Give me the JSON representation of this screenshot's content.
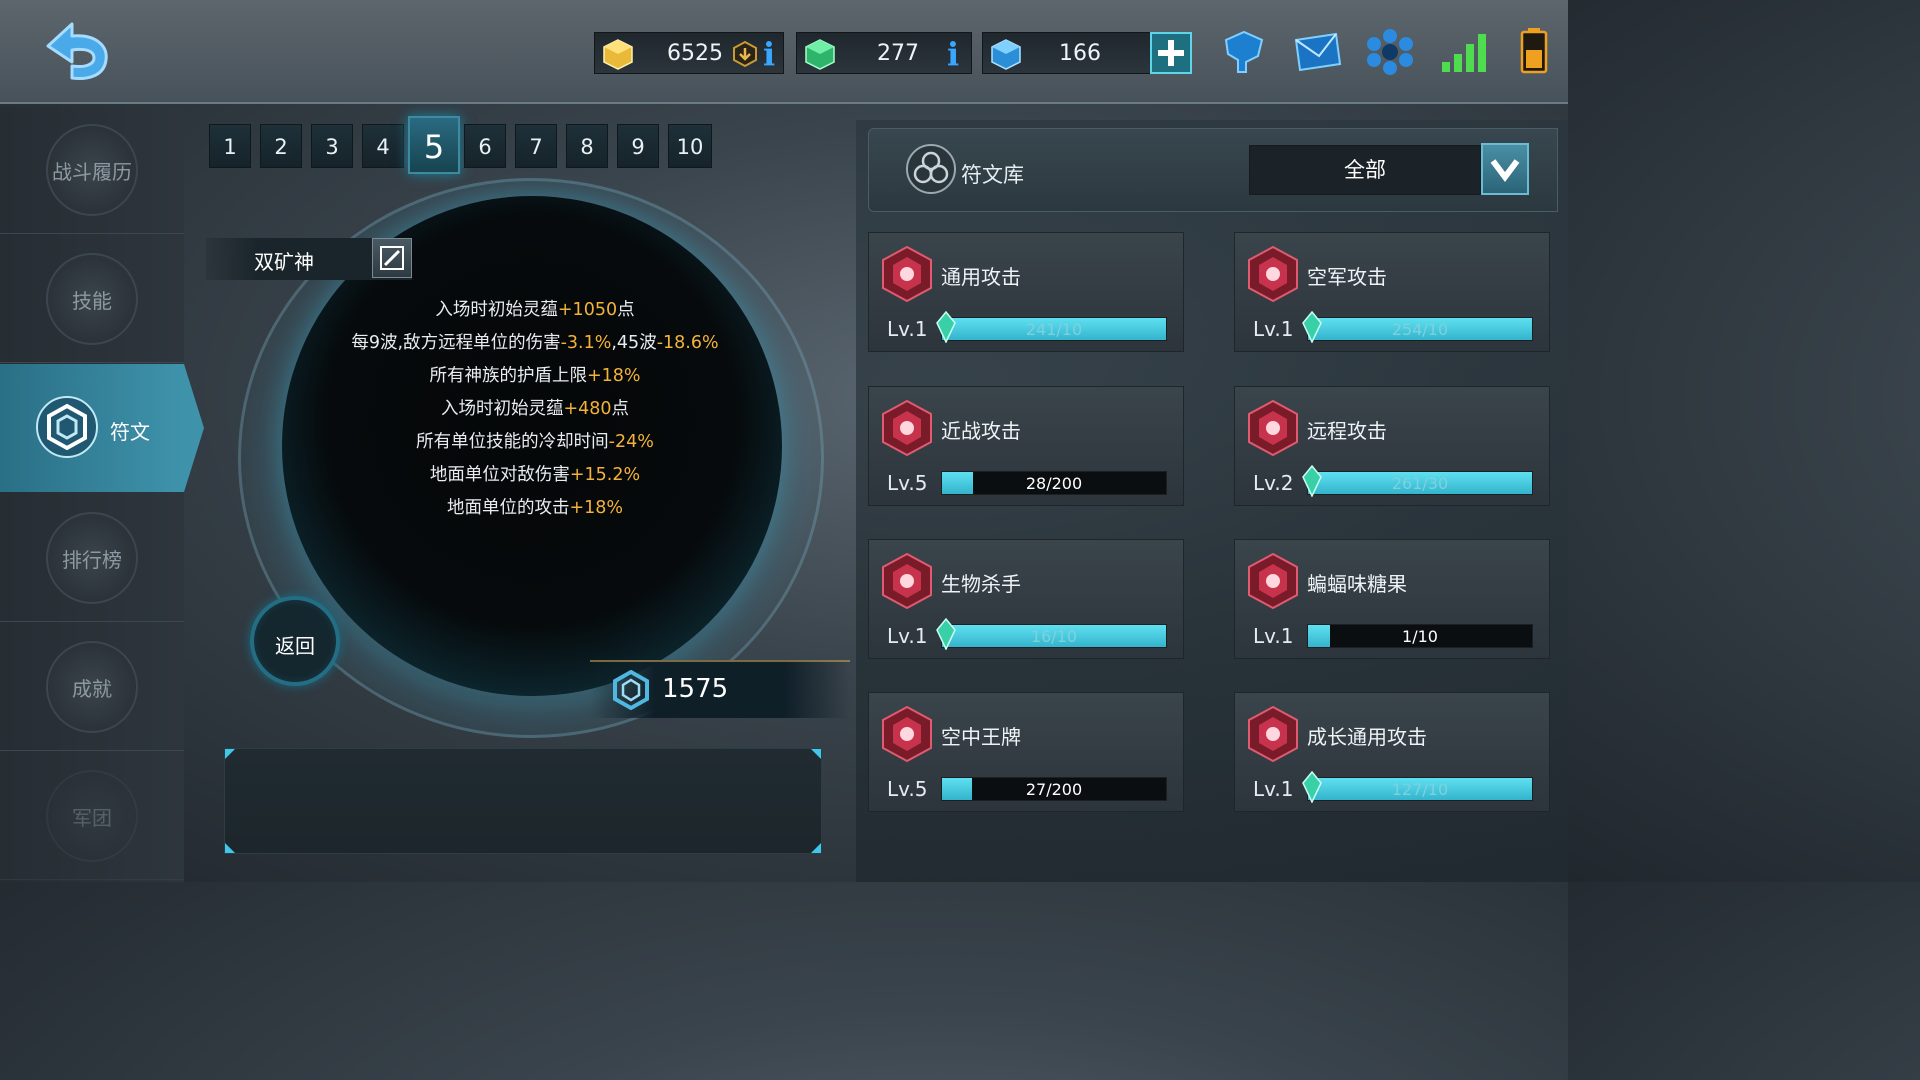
{
  "topbar": {
    "gold": "6525",
    "crystal": "277",
    "gems": "166",
    "info_label": "i",
    "colors": {
      "info": "#39a6ff",
      "plus": "#39c0d0",
      "signal": "#4fdc4f",
      "battery": "#f0a020"
    }
  },
  "nav": {
    "items": [
      {
        "label": "战斗履历"
      },
      {
        "label": "技能"
      },
      {
        "label": "符文"
      },
      {
        "label": "排行榜"
      },
      {
        "label": "成就"
      },
      {
        "label": "军团"
      }
    ],
    "active_index": 2
  },
  "tabs": [
    "1",
    "2",
    "3",
    "4",
    "5",
    "6",
    "7",
    "8",
    "9",
    "10"
  ],
  "active_tab": "5",
  "loadout": {
    "name": "双矿神",
    "effects": [
      {
        "text": "入场时初始灵蕴",
        "value": "+1050",
        "suffix": "点"
      },
      {
        "text": "每9波,敌方远程单位的伤害",
        "value": "-3.1%",
        "mid": ",45波",
        "value2": "-18.6%"
      },
      {
        "text": "所有神族的护盾上限",
        "value": "+18%"
      },
      {
        "text": "入场时初始灵蕴",
        "value": "+480",
        "suffix": "点"
      },
      {
        "text": "所有单位技能的冷却时间",
        "value": "-24%"
      },
      {
        "text": "地面单位对敌伤害",
        "value": "+15.2%"
      },
      {
        "text": "地面单位的攻击",
        "value": "+18%"
      }
    ],
    "return_label": "返回",
    "score": "1575"
  },
  "library": {
    "title": "符文库",
    "filter_value": "全部",
    "runes": [
      {
        "name": "通用攻击",
        "level": "Lv.1",
        "progress_text": "241/10",
        "progress": 1.0,
        "maxed": true
      },
      {
        "name": "空军攻击",
        "level": "Lv.1",
        "progress_text": "254/10",
        "progress": 1.0,
        "maxed": true
      },
      {
        "name": "近战攻击",
        "level": "Lv.5",
        "progress_text": "28/200",
        "progress": 0.14,
        "maxed": false
      },
      {
        "name": "远程攻击",
        "level": "Lv.2",
        "progress_text": "261/30",
        "progress": 1.0,
        "maxed": true
      },
      {
        "name": "生物杀手",
        "level": "Lv.1",
        "progress_text": "16/10",
        "progress": 1.0,
        "maxed": true
      },
      {
        "name": "蝙蝠味糖果",
        "level": "Lv.1",
        "progress_text": "1/10",
        "progress": 0.1,
        "maxed": false
      },
      {
        "name": "空中王牌",
        "level": "Lv.5",
        "progress_text": "27/200",
        "progress": 0.135,
        "maxed": false
      },
      {
        "name": "成长通用攻击",
        "level": "Lv.1",
        "progress_text": "127/10",
        "progress": 1.0,
        "maxed": true
      }
    ]
  }
}
